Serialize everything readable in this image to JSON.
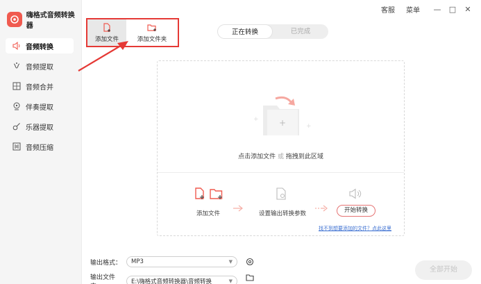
{
  "app": {
    "title": "嗨格式音频转换器"
  },
  "topbar": {
    "service": "客服",
    "menu": "菜单",
    "minimize": "—",
    "maximize": "□",
    "close": "✕"
  },
  "sidebar": {
    "items": [
      {
        "label": "音频转换",
        "icon": "speaker-icon",
        "active": true
      },
      {
        "label": "音频提取",
        "icon": "extract-icon",
        "active": false
      },
      {
        "label": "音频合并",
        "icon": "merge-icon",
        "active": false
      },
      {
        "label": "伴奏提取",
        "icon": "accompaniment-icon",
        "active": false
      },
      {
        "label": "乐器提取",
        "icon": "guitar-icon",
        "active": false
      },
      {
        "label": "音频压缩",
        "icon": "compress-icon",
        "active": false
      }
    ]
  },
  "toolbar": {
    "add_file": "添加文件",
    "add_folder": "添加文件夹"
  },
  "tabs": {
    "converting": "正在转换",
    "completed": "已完成"
  },
  "dropzone": {
    "hint_click": "点击添加文件",
    "hint_or": "或",
    "hint_drag": "拖拽到此区域",
    "step1": "添加文件",
    "step2": "设置输出转换参数",
    "step3": "开始转换",
    "help_link": "找不到想要添加的文件？点此这里"
  },
  "output": {
    "format_label": "输出格式：",
    "format_value": "MP3",
    "folder_label": "输出文件夹：",
    "folder_value": "E:\\嗨格式音频转换器\\音频转换"
  },
  "start_all": "全部开始",
  "colors": {
    "accent": "#f05a4f",
    "highlight_box": "#e53935",
    "link": "#3b6fd1"
  }
}
